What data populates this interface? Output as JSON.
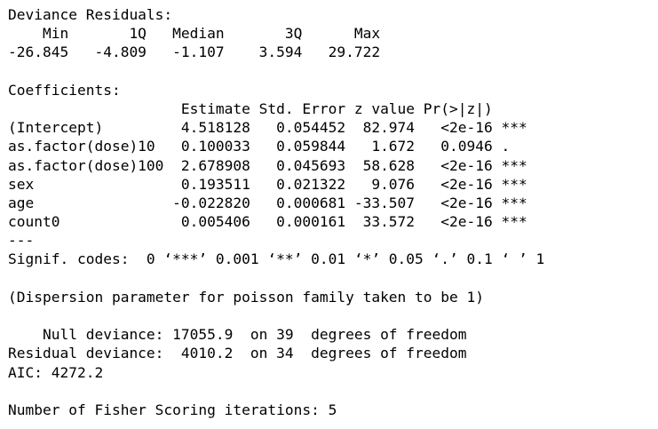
{
  "console": {
    "deviance_residuals": {
      "title": "Deviance Residuals: ",
      "header": "    Min       1Q   Median       3Q      Max  ",
      "values": "-26.845   -4.809   -1.107    3.594   29.722  "
    },
    "coefficients": {
      "title": "Coefficients:",
      "header": "                    Estimate Std. Error z value Pr(>|z|)    ",
      "rows": [
        "(Intercept)         4.518128   0.054452  82.974   <2e-16 ***",
        "as.factor(dose)10   0.100033   0.059844   1.672   0.0946 .  ",
        "as.factor(dose)100  2.678908   0.045693  58.628   <2e-16 ***",
        "sex                 0.193511   0.021322   9.076   <2e-16 ***",
        "age                -0.022820   0.000681 -33.507   <2e-16 ***",
        "count0              0.005406   0.000161  33.572   <2e-16 ***"
      ],
      "separator": "---",
      "signif_codes": "Signif. codes:  0 ‘***’ 0.001 ‘**’ 0.01 ‘*’ 0.05 ‘.’ 0.1 ‘ ’ 1"
    },
    "dispersion": "(Dispersion parameter for poisson family taken to be 1)",
    "null_deviance": "    Null deviance: 17055.9  on 39  degrees of freedom",
    "residual_deviance": "Residual deviance:  4010.2  on 34  degrees of freedom",
    "aic": "AIC: 4272.2",
    "fisher_iterations": "Number of Fisher Scoring iterations: 5"
  }
}
